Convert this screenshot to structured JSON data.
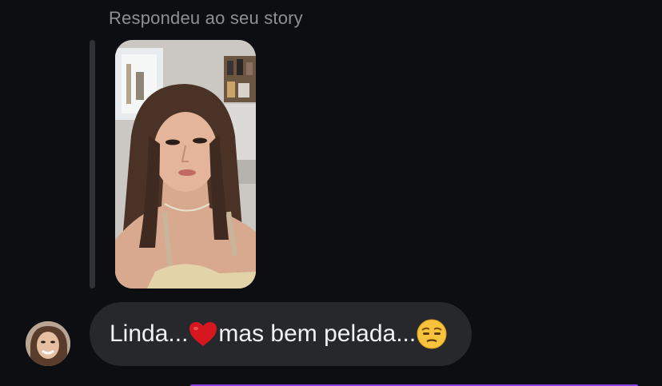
{
  "conversation": {
    "reply_label": "Respondeu ao seu story",
    "story_preview": {
      "kind": "photo",
      "description_icon": "story-photo"
    },
    "message": {
      "text_part1": "Linda...",
      "emoji1": "heart-icon",
      "text_part2": "mas bem pelada...",
      "emoji2": "unamused-face-icon"
    },
    "sender_avatar": "avatar"
  },
  "colors": {
    "background": "#0c0e12",
    "bubble": "#26282c",
    "label": "#8e9096",
    "heart": "#d7171f",
    "accent": "#8e3fe0"
  }
}
